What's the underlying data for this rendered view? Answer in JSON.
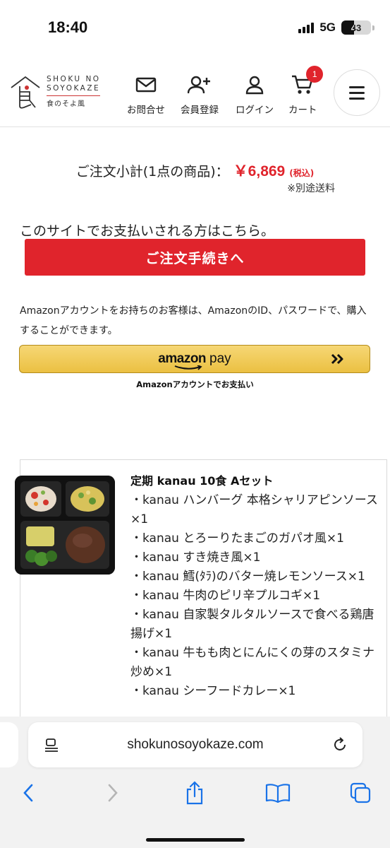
{
  "status_bar": {
    "time": "18:40",
    "network": "5G",
    "battery": "43",
    "battery_level": 0.43
  },
  "header": {
    "logo": {
      "en_line1": "SHOKU NO",
      "en_line2": "SOYOKAZE",
      "jp": "食のそよ風"
    },
    "nav": [
      {
        "label": "お問合せ",
        "icon": "mail-icon"
      },
      {
        "label": "会員登録",
        "icon": "add-user-icon"
      },
      {
        "label": "ログイン",
        "icon": "user-icon"
      },
      {
        "label": "カート",
        "icon": "cart-icon"
      }
    ],
    "cart_count": "1",
    "menu_icon": "hamburger-icon"
  },
  "order": {
    "subtotal_label": "ご注文小計(1点の商品)：",
    "subtotal_price": "￥6,869",
    "tax_label": "(税込)",
    "shipping_note": "※別途送料",
    "pay_intro": "このサイトでお支払いされる方はこちら。",
    "checkout_button": "ご注文手続きへ",
    "amazon_note": "Amazonアカウントをお持ちのお客様は、AmazonのID、パスワードで、購入することができます。",
    "amazon_button_brand": "amazon",
    "amazon_button_pay": "pay",
    "amazon_caption": "Amazonアカウントでお支払い"
  },
  "product": {
    "name": "定期 kanau 10食 Aセット",
    "items": [
      "・kanau ハンバーグ 本格シャリアピンソース×1",
      "・kanau とろーりたまごのガパオ風×1",
      "・kanau すき焼き風×1",
      "・kanau 鱈(ﾀﾗ)のバター焼レモンソース×1",
      "・kanau 牛肉のピリ辛プルコギ×1",
      "・kanau 自家製タルタルソースで食べる鶏唐揚げ×1",
      "・kanau 牛もも肉とにんにくの芽のスタミナ炒め×1",
      "・kanau シーフードカレー×1"
    ]
  },
  "browser": {
    "url": "shokunosoyokaze.com",
    "accent": "#1a73e8"
  }
}
